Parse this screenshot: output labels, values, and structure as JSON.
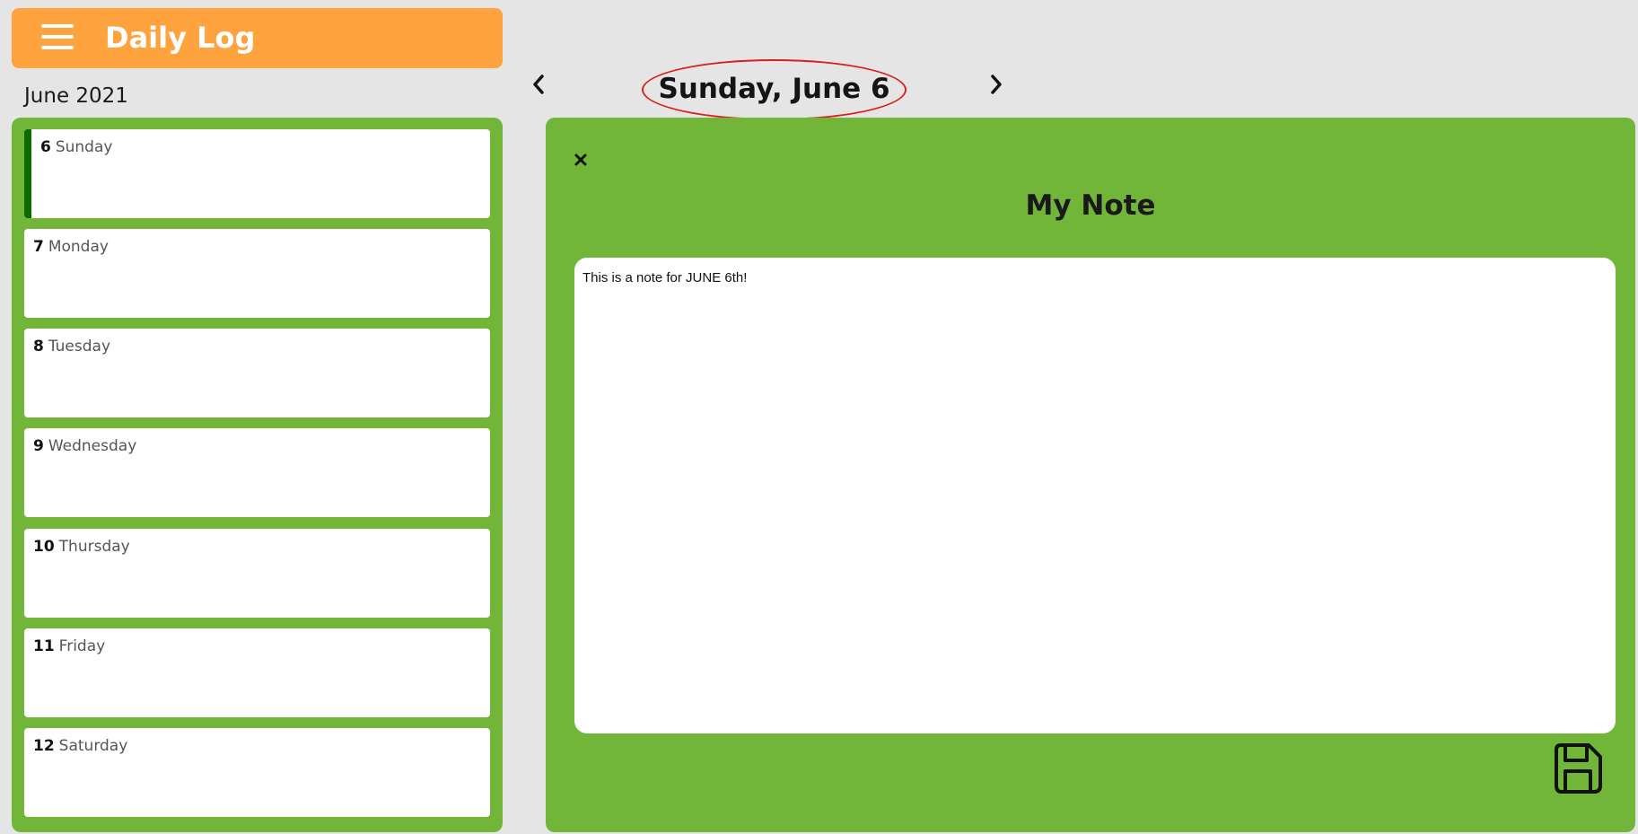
{
  "header": {
    "title": "Daily Log",
    "color": "#ffa33f"
  },
  "sidebar": {
    "month": "June 2021",
    "days": [
      {
        "num": "6",
        "weekday": "Sunday",
        "selected": true
      },
      {
        "num": "7",
        "weekday": "Monday",
        "selected": false
      },
      {
        "num": "8",
        "weekday": "Tuesday",
        "selected": false
      },
      {
        "num": "9",
        "weekday": "Wednesday",
        "selected": false
      },
      {
        "num": "10",
        "weekday": "Thursday",
        "selected": false
      },
      {
        "num": "11",
        "weekday": "Friday",
        "selected": false
      },
      {
        "num": "12",
        "weekday": "Saturday",
        "selected": false
      }
    ]
  },
  "date_nav": {
    "prev_icon": "chevron-left-icon",
    "next_icon": "chevron-right-icon",
    "current_date": "Sunday, June 6"
  },
  "note": {
    "close_icon": "close-icon",
    "title": "My Note",
    "text": "This is a note for JUNE 6th!",
    "save_icon": "floppy-disk-icon"
  },
  "colors": {
    "panel_green": "#72b639",
    "selected_accent": "#0b6b00",
    "highlight_circle": "#d8201c"
  }
}
